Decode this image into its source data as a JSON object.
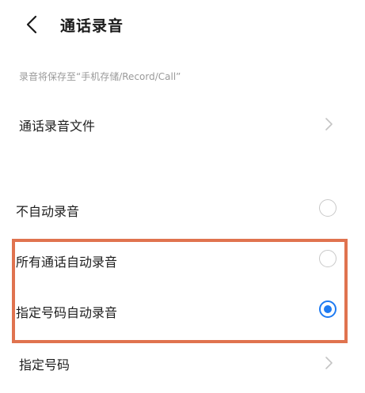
{
  "header": {
    "title": "通话录音"
  },
  "save_hint": "录音将保存至“手机存储/Record/Call”",
  "items": {
    "recording_files": {
      "label": "通话录音文件"
    },
    "no_auto_record": {
      "label": "不自动录音",
      "checked": false
    },
    "all_calls_auto": {
      "label": "所有通话自动录音",
      "checked": false
    },
    "specified_auto": {
      "label": "指定号码自动录音",
      "checked": true
    },
    "specified_numbers": {
      "label": "指定号码"
    }
  },
  "colors": {
    "accent": "#1e7bf2",
    "highlight": "#e0734f"
  },
  "icons": {
    "back": "chevron-left-icon",
    "forward": "chevron-right-icon"
  }
}
